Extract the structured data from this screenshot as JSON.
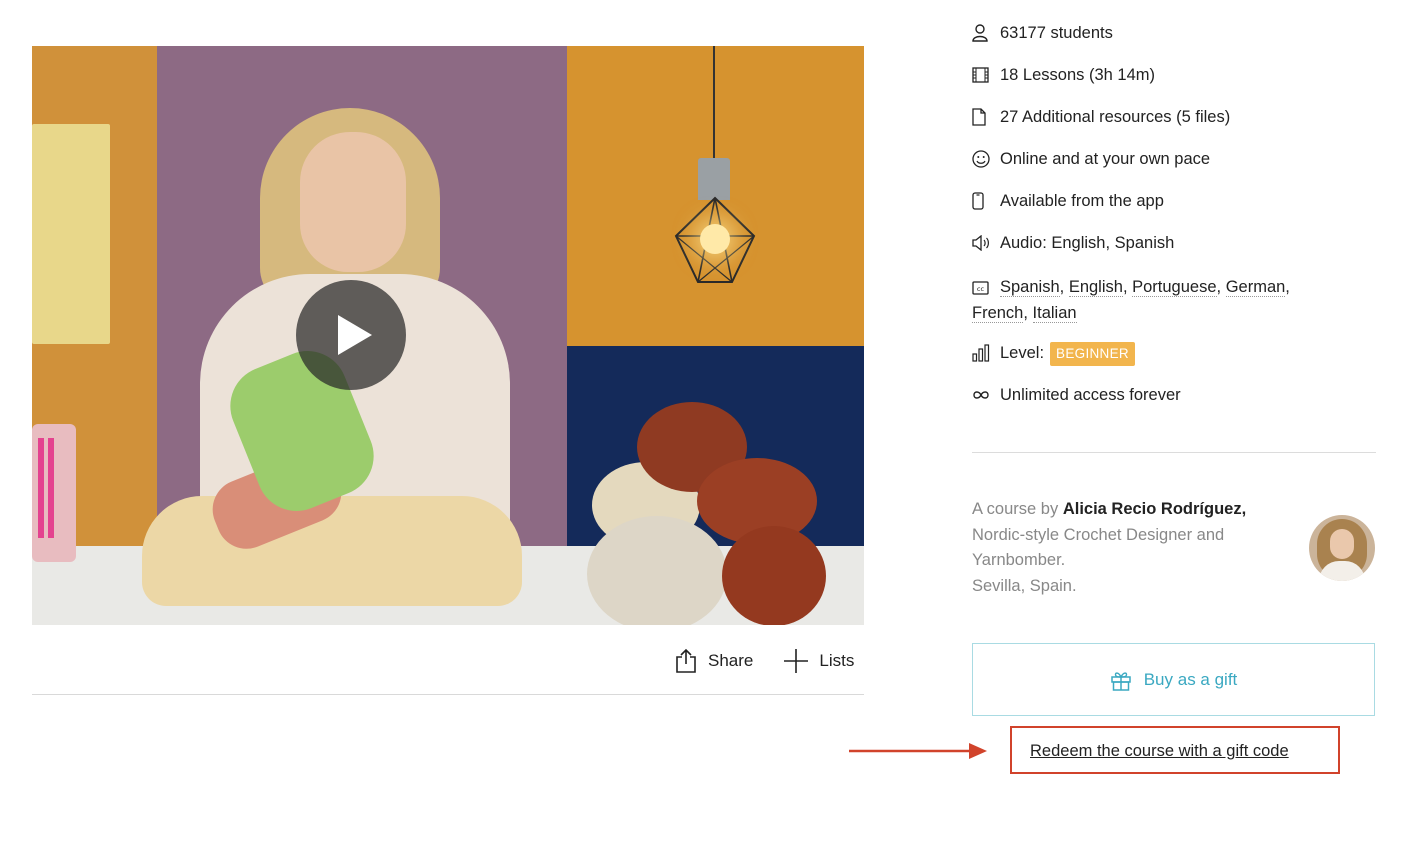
{
  "features": {
    "students": "63177 students",
    "lessons": "18 Lessons (3h 14m)",
    "resources": "27 Additional resources (5 files)",
    "pace": "Online and at your own pace",
    "app": "Available from the app",
    "audio": "Audio: English, Spanish",
    "subtitles": [
      "Spanish",
      "English",
      "Portuguese",
      "German",
      "French",
      "Italian"
    ],
    "level_label": "Level:",
    "level_value": "BEGINNER",
    "access": "Unlimited access forever"
  },
  "author": {
    "prefix": "A course by",
    "name": "Alicia Recio Rodríguez,",
    "title": "Nordic-style Crochet Designer and Yarnbomber.",
    "location": "Sevilla, Spain."
  },
  "actions": {
    "share": "Share",
    "lists": "Lists"
  },
  "gift": {
    "buy_label": "Buy as a gift",
    "redeem_label": "Redeem the course with a gift code"
  },
  "colors": {
    "level_badge": "#f2b54d",
    "gift_accent": "#3aa8c1",
    "annotation_red": "#d1432b"
  }
}
